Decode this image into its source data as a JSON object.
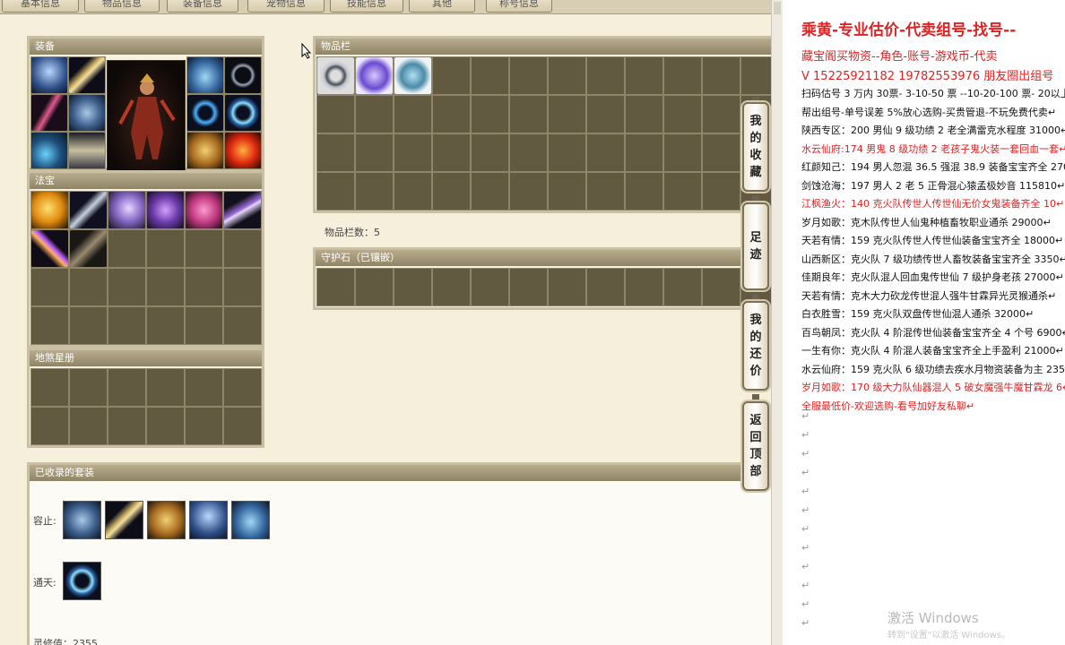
{
  "tabs": [
    "基本信息",
    "物品信息",
    "装备信息",
    "宠物信息",
    "技能信息",
    "其他",
    "称号信息"
  ],
  "panels": {
    "equipment": "装备",
    "treasure": "法宝",
    "soul_book": "地煞星册",
    "inventory": "物品栏",
    "guard_stone": "守护石（已镶嵌）",
    "collected_sets": "已收录的套装"
  },
  "inventory_count": "物品栏数：5",
  "sets": [
    {
      "label": "容止:",
      "count": 5
    },
    {
      "label": "通天:",
      "count": 1
    }
  ],
  "spirit_value": "灵修值：2355",
  "side_buttons": [
    "我的收藏",
    "足迹",
    "我的还价",
    "返回顶部"
  ],
  "icons": {
    "equip_left": [
      "helmet-icon",
      "weapon-icon",
      "staff-icon",
      "robe-icon",
      "necklace-icon",
      "boots-icon"
    ],
    "equip_right": [
      "crown-icon",
      "bracelet-icon",
      "ring-icon",
      "fairy-ring-icon",
      "belt-icon",
      "red-orb-icon"
    ],
    "treasure": [
      "gold-cloud-icon",
      "claw-icon",
      "bell-icon",
      "lantern-icon",
      "pink-lamp-icon",
      "book-icon",
      "wand-icon",
      "box-icon"
    ],
    "inventory": [
      "ring-item-icon",
      "purple-scarf-icon",
      "tiara-icon"
    ],
    "set_rongzhi": [
      "robe-icon",
      "weapon-icon",
      "belt-icon",
      "helmet-icon",
      "crown-icon"
    ],
    "set_tongtian": [
      "fairy-ring-icon"
    ]
  },
  "listing": {
    "title": "乘黄-专业估价-代卖组号-找号--",
    "lines": [
      {
        "text": "藏宝阁买物资--角色-账号-游戏币-代卖",
        "red": true
      },
      {
        "text": "V 15225921182    19782553976 朋友圈出组号",
        "red": true
      },
      {
        "text": "扫码估号 3 万内 30票- 3-10-50 票  --10-20-100 票- 20以上 1",
        "red": false
      },
      {
        "text": "帮出组号-单号误差 5%放心选购-买贵管退-不玩免费代卖",
        "red": false
      },
      {
        "text": "陕西专区：200 男仙 9 级功绩 2 老全满雷克水程度 31000",
        "red": false
      },
      {
        "text": "水云仙府:174 男鬼 8 级功绩 2 老孩子鬼火装一套回血一套",
        "red": true
      },
      {
        "text": "红颜知己：194 男人忽混 36.5 强混 38.9 装备宝宝齐全 2700",
        "red": false
      },
      {
        "text": "剑蚀沧海：197 男人 2 老 5 正骨混心猿孟极妙音 115810",
        "red": false
      },
      {
        "text": "江枫渔火：140 克火队传世人传世仙无价女鬼装备齐全 10",
        "red": true
      },
      {
        "text": "岁月如歌：克木队传世人仙鬼种植畜牧职业通杀 29000",
        "red": false
      },
      {
        "text": "天若有情：159 克火队传世人传世仙装备宝宝齐全 18000",
        "red": false
      },
      {
        "text": "山西新区：克火队 7 级功绩传世人畜牧装备宝宝齐全 3350",
        "red": false
      },
      {
        "text": "佳期良年：克火队混人回血鬼传世仙 7 级护身老孩 27000",
        "red": false
      },
      {
        "text": "天若有情：克木大力砍龙传世混人强牛甘霖异光灵猴通杀",
        "red": false
      },
      {
        "text": "白衣胜雪：159 克火队双盘传世仙混人通杀 32000",
        "red": false
      },
      {
        "text": "百鸟朝凤：克火队 4 阶混传世仙装备宝宝齐全 4 个号 6900",
        "red": false
      },
      {
        "text": "一生有你：克火队 4 阶混人装备宝宝齐全上手盈利 21000",
        "red": false
      },
      {
        "text": "水云仙府：159 克火队 6 级功绩去疾水月物资装备为主 235",
        "red": false
      },
      {
        "text": "岁月如歌：170 级大力队仙器混人 5 破女魔强牛魔甘霖龙 6",
        "red": true
      },
      {
        "text": "全服最低价-欢迎选购-看号加好友私聊",
        "red": true
      }
    ],
    "return_mark": "↵"
  },
  "watermark": {
    "title": "激活 Windows",
    "sub": "转到\"设置\"以激活 Windows。"
  },
  "colors": {
    "red": "#e02222",
    "panel_header": "#9a8f70",
    "slot": "#615a40"
  }
}
